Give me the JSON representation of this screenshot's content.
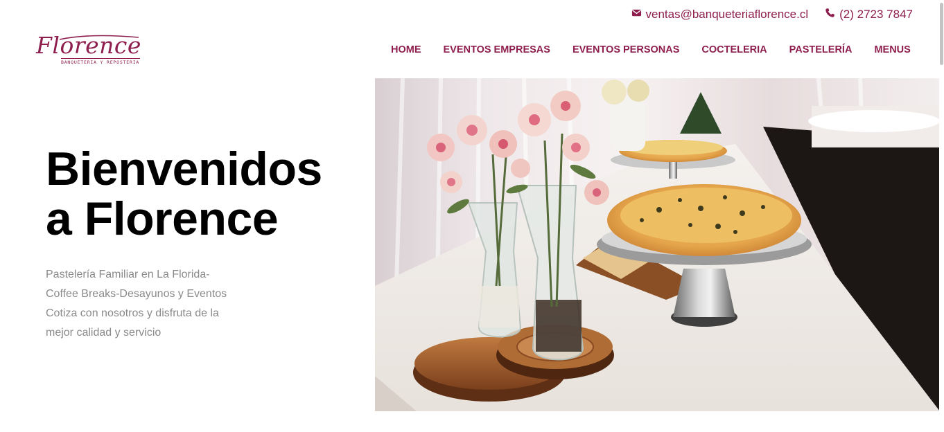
{
  "topbar": {
    "email": "ventas@banqueteriaflorence.cl",
    "email_icon": "envelope-icon",
    "phone": "(2) 2723 7847",
    "phone_icon": "phone-icon"
  },
  "logo": {
    "name": "Florence",
    "tagline": "BANQUETERIA Y REPOSTERIA"
  },
  "nav": {
    "items": [
      {
        "label": "HOME"
      },
      {
        "label": "EVENTOS EMPRESAS"
      },
      {
        "label": "EVENTOS PERSONAS"
      },
      {
        "label": "COCTELERIA"
      },
      {
        "label": "PASTELERÍA"
      },
      {
        "label": "MENUS"
      }
    ]
  },
  "hero": {
    "title_line1": "Bienvenidos",
    "title_line2": "a Florence",
    "desc_line1": "Pastelería Familiar en La Florida-",
    "desc_line2": "Coffee Breaks-Desayunos y Eventos",
    "desc_line3": "Cotiza con nosotros y disfruta de la",
    "desc_line4": "mejor calidad y servicio"
  },
  "colors": {
    "brand": "#8e1e4d",
    "title": "#000000",
    "body_text": "#8a8a8a"
  }
}
